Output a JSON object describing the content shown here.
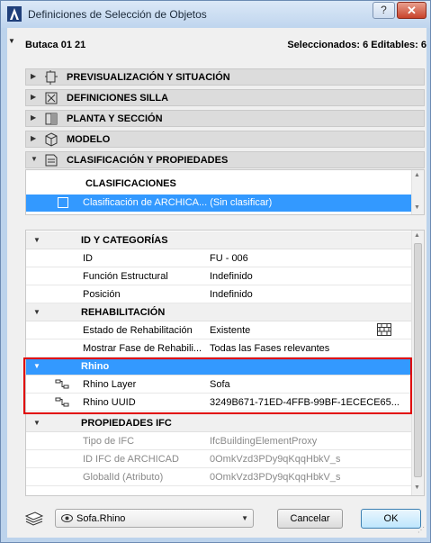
{
  "window": {
    "title": "Definiciones de Selección de Objetos",
    "help_label": "?",
    "close_label": "✕"
  },
  "header": {
    "object_name": "Butaca 01 21",
    "selection_info": "Seleccionados: 6 Editables: 6"
  },
  "sections": [
    {
      "label": "PREVISUALIZACIÓN Y SITUACIÓN",
      "icon": "preview-position-icon",
      "expanded": false
    },
    {
      "label": "DEFINICIONES SILLA",
      "icon": "chair-settings-icon",
      "expanded": false
    },
    {
      "label": "PLANTA Y SECCIÓN",
      "icon": "floor-plan-icon",
      "expanded": false
    },
    {
      "label": "MODELO",
      "icon": "model-cube-icon",
      "expanded": false
    },
    {
      "label": "CLASIFICACIÓN Y PROPIEDADES",
      "icon": "classification-icon",
      "expanded": true
    }
  ],
  "classifications": {
    "header": "CLASIFICACIONES",
    "row_text": "Clasificación de ARCHICA... (Sin clasificar)"
  },
  "properties": {
    "groups": [
      {
        "name": "ID Y CATEGORÍAS",
        "rows": [
          {
            "name": "ID",
            "value": "FU - 006"
          },
          {
            "name": "Función Estructural",
            "value": "Indefinido"
          },
          {
            "name": "Posición",
            "value": "Indefinido"
          }
        ]
      },
      {
        "name": "REHABILITACIÓN",
        "rows": [
          {
            "name": "Estado de Rehabilitación",
            "value": "Existente"
          },
          {
            "name": "Mostrar Fase de Rehabili...",
            "value": "Todas las Fases relevantes"
          }
        ]
      },
      {
        "name": "Rhino",
        "rows": [
          {
            "name": "Rhino Layer",
            "value": "Sofa"
          },
          {
            "name": "Rhino UUID",
            "value": "3249B671-71ED-4FFB-99BF-1ECECE65..."
          }
        ]
      },
      {
        "name": "PROPIEDADES IFC",
        "rows": [
          {
            "name": "Tipo de IFC",
            "value": "IfcBuildingElementProxy"
          },
          {
            "name": "ID IFC de ARCHICAD",
            "value": "0OmkVzd3PDy9qKqqHbkV_s"
          },
          {
            "name": "GlobalId (Atributo)",
            "value": "0OmkVzd3PDy9qKqqHbkV_s"
          }
        ]
      }
    ]
  },
  "footer": {
    "library_value": "Sofa.Rhino",
    "cancel_label": "Cancelar",
    "ok_label": "OK"
  },
  "colors": {
    "selection": "#3399ff",
    "highlight_border": "#e00000"
  }
}
